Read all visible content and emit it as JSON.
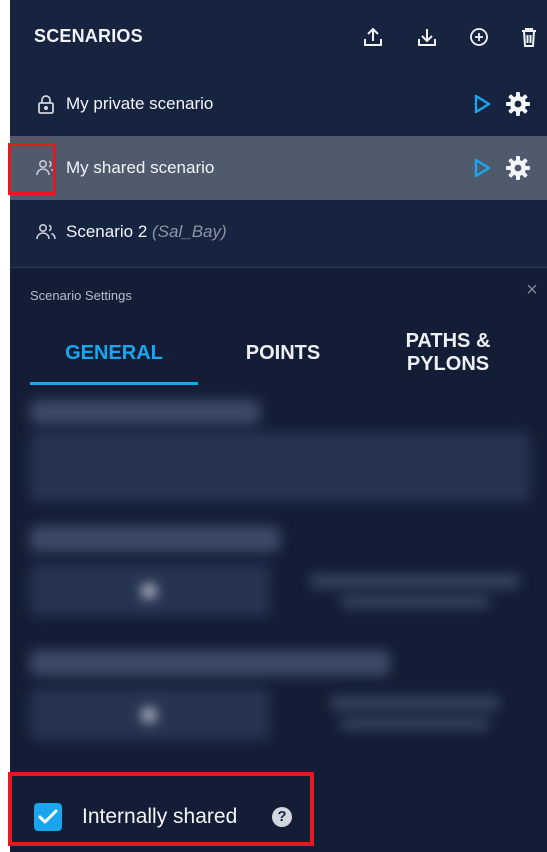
{
  "header": {
    "title": "SCENARIOS",
    "icons": [
      "upload-icon",
      "download-icon",
      "add-circle-icon",
      "trash-icon"
    ]
  },
  "scenarios": [
    {
      "icon": "lock-icon",
      "name": "My private scenario",
      "sub": "",
      "selected": false,
      "has_actions": true
    },
    {
      "icon": "users-icon",
      "name": "My shared scenario",
      "sub": "",
      "selected": true,
      "has_actions": true
    },
    {
      "icon": "users-icon",
      "name": "Scenario 2",
      "sub": "(Sal_Bay)",
      "selected": false,
      "has_actions": false
    }
  ],
  "settings": {
    "title": "Scenario Settings",
    "close_label": "×",
    "tabs": [
      "GENERAL",
      "POINTS",
      "PATHS & PYLONS"
    ],
    "active_tab": "GENERAL"
  },
  "internal_share": {
    "label": "Internally shared",
    "checked": true,
    "help_glyph": "?"
  },
  "colors": {
    "panel_bg": "#172440",
    "selected_row": "#4f5a6c",
    "accent": "#1aa6ee",
    "highlight": "#e11a22"
  }
}
